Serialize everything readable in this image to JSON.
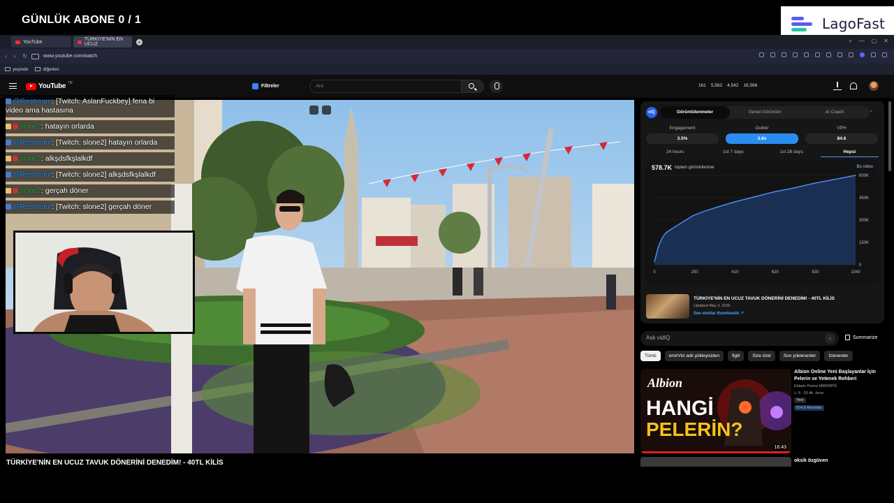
{
  "overlay": {
    "title": "GÜNLÜK ABONE 0 / 1",
    "brand": "LagoFast"
  },
  "browser": {
    "tabs": [
      {
        "label": "YouTube"
      },
      {
        "label": "TÜRKİYE'NİN EN UCUZ"
      }
    ],
    "url": "www.youtube.com/watch",
    "bookmarks": [
      "yeşinde",
      "diğerleri"
    ]
  },
  "youtube": {
    "logo": "YouTube",
    "region": "TR",
    "filters_label": "Filtreler",
    "search_placeholder": "Ara",
    "stats": [
      "161",
      "5,562",
      "4,542",
      "16,566"
    ]
  },
  "video": {
    "title": "TÜRKİYE'NİN EN UCUZ TAVUK DÖNERİNİ DENEDİM! - 40TL KİLİS"
  },
  "chat": [
    {
      "user": "@Restream",
      "text": ": [Twitch: AslanFuckbey] fena bi video ama hastasına"
    },
    {
      "user": "slone2",
      "text": ": hatayın orlarda"
    },
    {
      "user": "@Restream",
      "text": ": [Twitch: slone2] hatayın orlarda"
    },
    {
      "user": "slone2",
      "text": ": alkşdsfkşlalkdf"
    },
    {
      "user": "@Restream",
      "text": ": [Twitch: slone2] alkşdsfkşlalkdf"
    },
    {
      "user": "slone2",
      "text": ": gerçah döner"
    },
    {
      "user": "@Restream",
      "text": ": [Twitch: slone2] gerçah döner"
    }
  ],
  "panel": {
    "logo": "viQ",
    "tabs": [
      "Görüntülenmeler",
      "Genel Görünüm",
      "AI Coach"
    ],
    "metrics": [
      {
        "label": "Engagement",
        "value": "3.5%"
      },
      {
        "label": "Outlier",
        "value": "3.6x"
      },
      {
        "label": "VPH",
        "value": "84.6"
      }
    ],
    "ranges": [
      "24 hours",
      "1st 7 days",
      "1st 28 days",
      "Hepsi"
    ],
    "total": "578.7K",
    "total_label": "toplam görüntülenme",
    "legend": "Bu video",
    "video_title": "TÜRKİYE'NİN EN UCUZ TAVUK DÖNERİNİ DENEDİM! - 40TL KİLİS",
    "video_date": "Updated May 3, 2026",
    "similar_link": "See similar thumbnails ↗"
  },
  "chart_data": {
    "type": "area",
    "x": [
      0,
      20,
      40,
      60,
      100,
      150,
      200,
      260,
      320,
      410,
      500,
      620,
      720,
      820,
      920,
      1040
    ],
    "series": [
      {
        "name": "Bu video",
        "values": [
          20000,
          120000,
          180000,
          215000,
          250000,
          290000,
          330000,
          360000,
          385000,
          420000,
          450000,
          490000,
          515000,
          545000,
          570000,
          600000
        ]
      }
    ],
    "xticks": [
      "0",
      "200",
      "410",
      "620",
      "830",
      "1040"
    ],
    "yticks": [
      "0",
      "150K",
      "300K",
      "450K",
      "600K"
    ],
    "xlim": [
      0,
      1040
    ],
    "ylim": [
      0,
      600000
    ],
    "grid": true,
    "legend_position": "top-right"
  },
  "below": {
    "ask_placeholder": "Ask vidIQ",
    "summarize": "Summarize",
    "chips": [
      "Tümü",
      "emirVicl adlı yükleyiciden",
      "İlgili",
      "Size özel",
      "Son yüklenenler",
      "İzlenenler"
    ],
    "rec": {
      "title": "Albion Online Yeni Başlayanlar İçin Pelerin ve Yetenek Rehberi",
      "channel": "Eldarin Prensi MMORPG",
      "meta": "▷ 9 · 53 dk. önce",
      "badge": "Yeni",
      "subs": "634.8 Abonelar",
      "duration": "16:43",
      "thumb_word1": "HANGİ",
      "thumb_word2": "PELERİN?",
      "thumb_brand": "Albion"
    },
    "rec2_title": "oksik özgüven"
  }
}
